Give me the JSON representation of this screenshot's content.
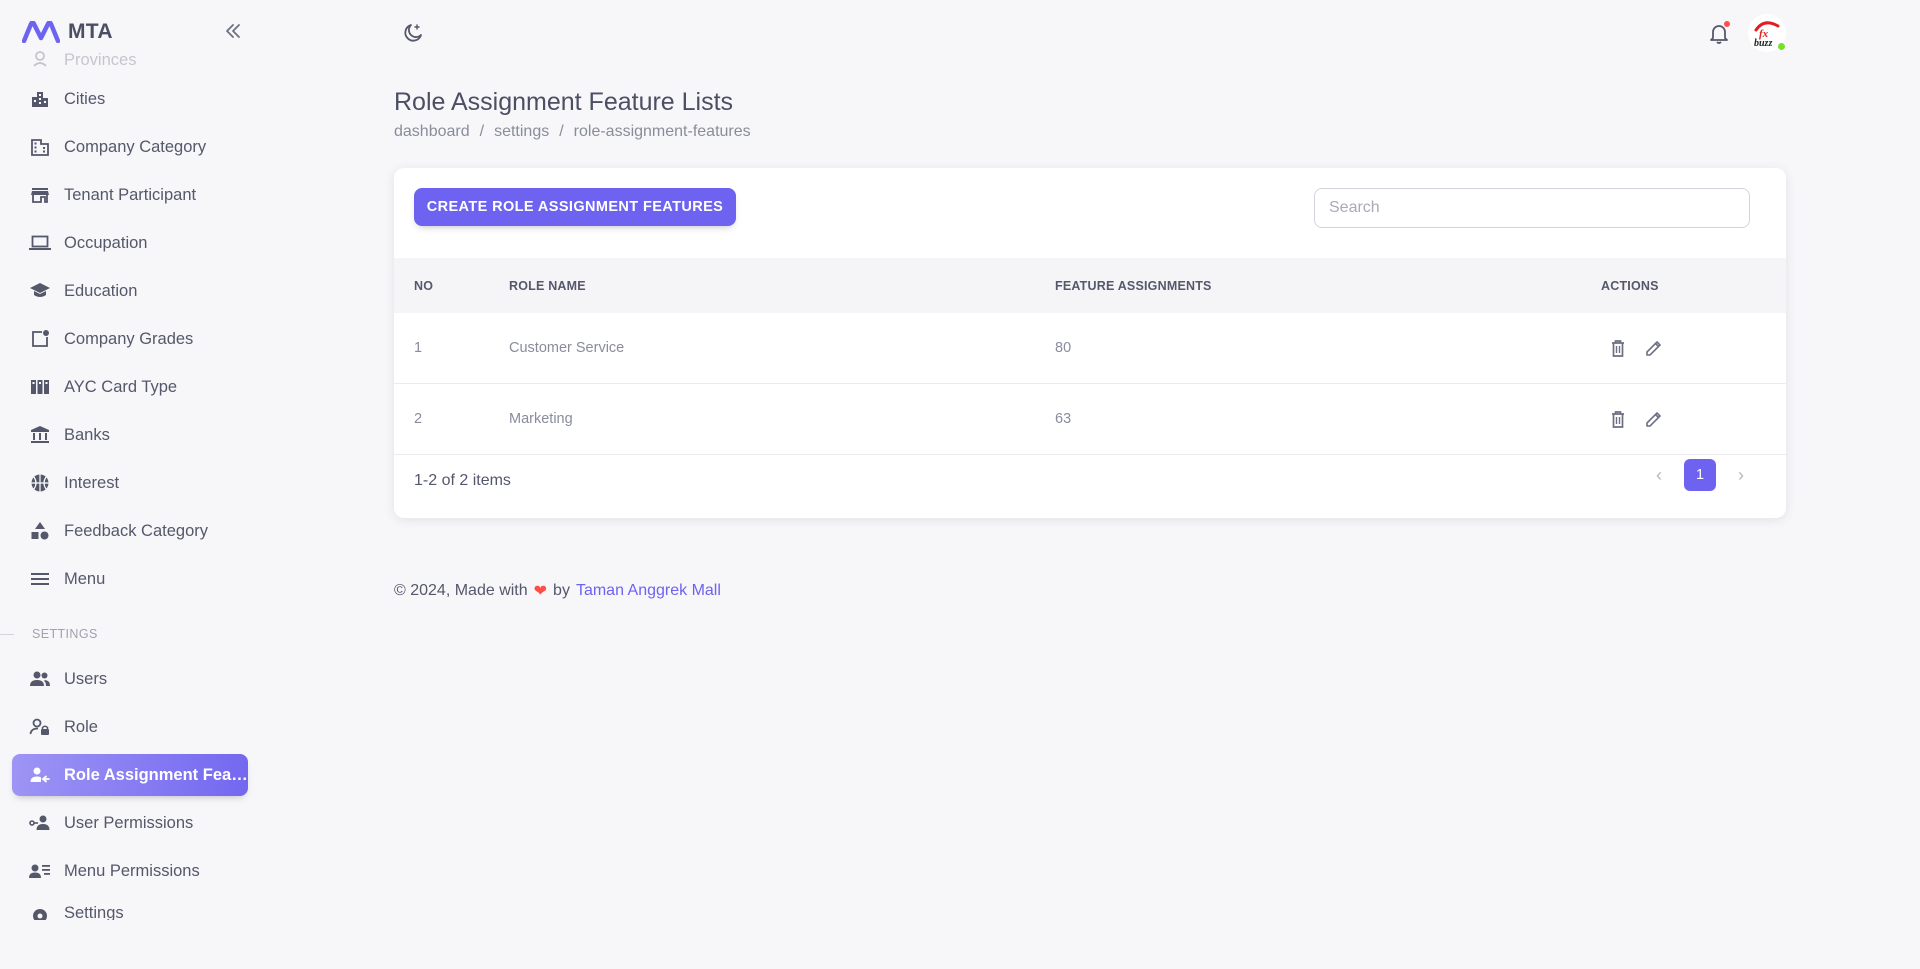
{
  "app": {
    "name": "MTA"
  },
  "sidebar": {
    "items_top": [
      {
        "label": "Provinces",
        "icon": "person-pin-icon"
      },
      {
        "label": "Cities",
        "icon": "city-icon"
      },
      {
        "label": "Company Category",
        "icon": "building-icon"
      },
      {
        "label": "Tenant Participant",
        "icon": "store-icon"
      },
      {
        "label": "Occupation",
        "icon": "laptop-icon"
      },
      {
        "label": "Education",
        "icon": "school-icon"
      },
      {
        "label": "Company Grades",
        "icon": "note-add-icon"
      },
      {
        "label": "AYC Card Type",
        "icon": "card-columns-icon"
      },
      {
        "label": "Banks",
        "icon": "bank-icon"
      },
      {
        "label": "Interest",
        "icon": "basketball-icon"
      },
      {
        "label": "Feedback Category",
        "icon": "shapes-icon"
      },
      {
        "label": "Menu",
        "icon": "menu-icon"
      }
    ],
    "section_settings": "SETTINGS",
    "items_settings": [
      {
        "label": "Users",
        "icon": "users-icon"
      },
      {
        "label": "Role",
        "icon": "user-lock-icon"
      },
      {
        "label": "Role Assignment Features",
        "icon": "user-assign-icon",
        "active": true
      },
      {
        "label": "User Permissions",
        "icon": "user-key-icon"
      },
      {
        "label": "Menu Permissions",
        "icon": "user-list-icon"
      },
      {
        "label": "Settings",
        "icon": "gear-icon"
      }
    ]
  },
  "header": {
    "title": "Role Assignment Feature Lists",
    "breadcrumb": [
      "dashboard",
      "settings",
      "role-assignment-features"
    ]
  },
  "toolbar": {
    "create_label": "CREATE ROLE ASSIGNMENT FEATURES",
    "search_placeholder": "Search"
  },
  "table": {
    "columns": [
      "NO",
      "ROLE NAME",
      "FEATURE ASSIGNMENTS",
      "ACTIONS"
    ],
    "rows": [
      {
        "no": "1",
        "role_name": "Customer Service",
        "feature_assignments": "80"
      },
      {
        "no": "2",
        "role_name": "Marketing",
        "feature_assignments": "63"
      }
    ],
    "summary": "1-2 of 2 items",
    "current_page": "1"
  },
  "footer": {
    "text": "© 2024, Made with",
    "by": "by",
    "link": "Taman Anggrek Mall"
  },
  "avatar": {
    "line1": "fx",
    "line2": "buzz"
  },
  "colors": {
    "primary": "#6e62f0",
    "danger": "#ff4d49",
    "online": "#72e128"
  }
}
